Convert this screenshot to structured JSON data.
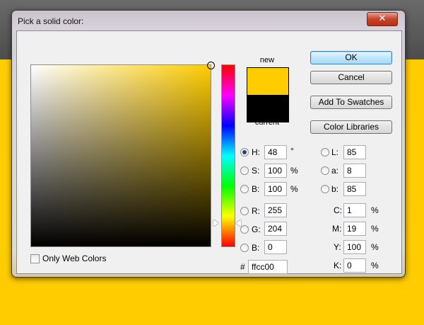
{
  "dialog": {
    "title": "Pick a solid color:",
    "close_glyph": "✕"
  },
  "buttons": {
    "ok": "OK",
    "cancel": "Cancel",
    "add_to_swatches": "Add To Swatches",
    "color_libraries": "Color Libraries"
  },
  "swatch": {
    "new_label": "new",
    "current_label": "current",
    "new_color": "#ffcc00",
    "current_color": "#000000"
  },
  "hsb": {
    "h": {
      "label": "H:",
      "value": "48",
      "unit": "°",
      "checked": true
    },
    "s": {
      "label": "S:",
      "value": "100",
      "unit": "%",
      "checked": false
    },
    "b": {
      "label": "B:",
      "value": "100",
      "unit": "%",
      "checked": false
    }
  },
  "rgb": {
    "r": {
      "label": "R:",
      "value": "255",
      "checked": false
    },
    "g": {
      "label": "G:",
      "value": "204",
      "checked": false
    },
    "b": {
      "label": "B:",
      "value": "0",
      "checked": false
    }
  },
  "lab": {
    "l": {
      "label": "L:",
      "value": "85",
      "checked": false
    },
    "a": {
      "label": "a:",
      "value": "8",
      "checked": false
    },
    "b": {
      "label": "b:",
      "value": "85",
      "checked": false
    }
  },
  "cmyk": {
    "c": {
      "label": "C:",
      "value": "1",
      "unit": "%"
    },
    "m": {
      "label": "M:",
      "value": "19",
      "unit": "%"
    },
    "y": {
      "label": "Y:",
      "value": "100",
      "unit": "%"
    },
    "k": {
      "label": "K:",
      "value": "0",
      "unit": "%"
    }
  },
  "hex": {
    "label": "#",
    "value": "ffcc00"
  },
  "web_colors": {
    "label": "Only Web Colors",
    "checked": false
  },
  "hue_fraction": 0.867
}
